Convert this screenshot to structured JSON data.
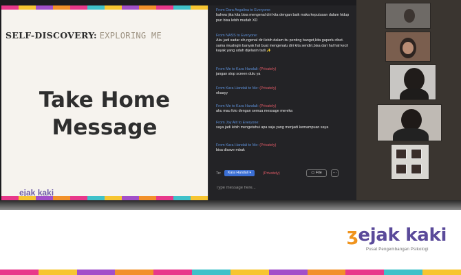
{
  "slide": {
    "heading_bold": "SELF-DISCOVERY:",
    "heading_thin": "EXPLORING ME",
    "title_line1": "Take Home",
    "title_line2": "Message",
    "logo": "ejak kaki"
  },
  "chat": {
    "messages": [
      {
        "from": "From Dara Angalina to Everyone:",
        "privately": "",
        "text": "bahwa jika kita bisa mengenal diri kita dengan baik maka keputusan dalam hidup pun bisa lebih mudah XD"
      },
      {
        "from": "From NASS to Everyone:",
        "privately": "",
        "text": "Aku jadi sadar sih,ngenal diri lebih dalam itu penting banget,kita gaperlu ribet. sama mualngin banyak hal buat mengenalu diri kita sendiri,bisa dari hal hal kecil kayak yang udah dijelasin tadi ✨"
      },
      {
        "from": "From Me to Kara Handali:",
        "privately": "(Privately)",
        "text": "jangan stop screen dulu ya"
      },
      {
        "from": "From Kara Handali to Me:",
        "privately": "(Privately)",
        "text": "okaayy"
      },
      {
        "from": "From Me to Kara Handali:",
        "privately": "(Privately)",
        "text": "aku mau foto dengan semua message mereka"
      },
      {
        "from": "From Joy Alit to Everyone:",
        "privately": "",
        "text": "saya jadi lebih mengetahui apa saja yang menjadi kemampuan saya"
      },
      {
        "from": "From Kara Handali to Me:",
        "privately": "(Privately)",
        "text": "bisa disave mbak"
      }
    ],
    "to_label": "To:",
    "recipient": "Kara Handali ▾",
    "privately": "(Privately)",
    "file_label": "File",
    "more_label": "···",
    "input_placeholder": "Type message here..."
  },
  "brand": {
    "logo_mark": "ʒ",
    "logo_text": "ejak kaki",
    "tagline": "Pusat Pengembangan Psikologi"
  },
  "colors": {
    "stripe": [
      "#e8388a",
      "#f7c531",
      "#a24fc9",
      "#f2902a",
      "#e8388a",
      "#3fc1c9",
      "#f7c531",
      "#a24fc9",
      "#f2902a",
      "#e8388a",
      "#3fc1c9",
      "#f7c531"
    ],
    "chat_sender": "#5d8fd6",
    "chat_private": "#e05a66",
    "brand_purple": "#5a4a9a",
    "brand_orange": "#f0941e"
  }
}
